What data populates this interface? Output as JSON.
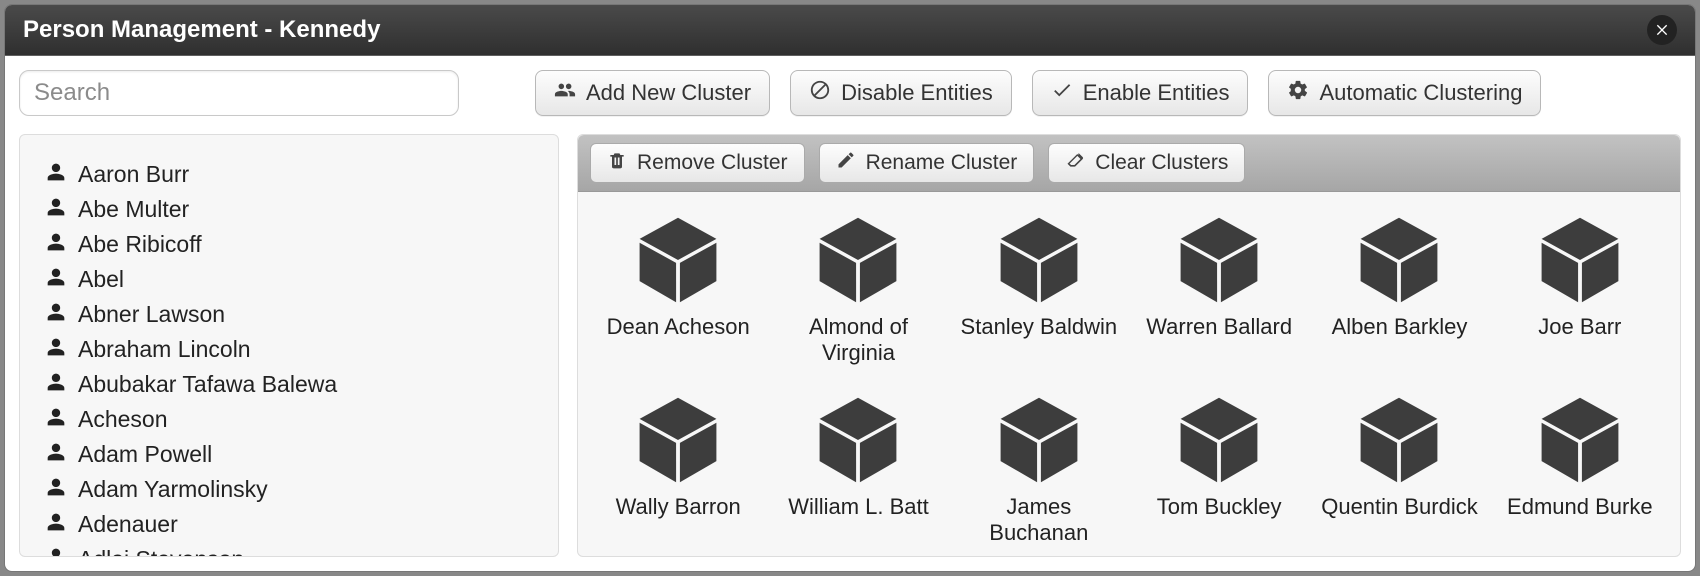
{
  "window": {
    "title": "Person Management - Kennedy"
  },
  "search": {
    "placeholder": "Search",
    "value": ""
  },
  "toolbar": {
    "add_cluster": "Add New Cluster",
    "disable_entities": "Disable Entities",
    "enable_entities": "Enable Entities",
    "auto_cluster": "Automatic Clustering"
  },
  "cluster_toolbar": {
    "remove": "Remove Cluster",
    "rename": "Rename Cluster",
    "clear": "Clear Clusters"
  },
  "people": [
    "Aaron Burr",
    "Abe Multer",
    "Abe Ribicoff",
    "Abel",
    "Abner Lawson",
    "Abraham Lincoln",
    "Abubakar Tafawa Balewa",
    "Acheson",
    "Adam Powell",
    "Adam Yarmolinsky",
    "Adenauer",
    "Adlai Stevenson"
  ],
  "clusters": [
    "Dean Acheson",
    "Almond of Virginia",
    "Stanley Baldwin",
    "Warren Ballard",
    "Alben Barkley",
    "Joe Barr",
    "Wally Barron",
    "William L. Batt",
    "James Buchanan",
    "Tom Buckley",
    "Quentin Burdick",
    "Edmund Burke"
  ]
}
